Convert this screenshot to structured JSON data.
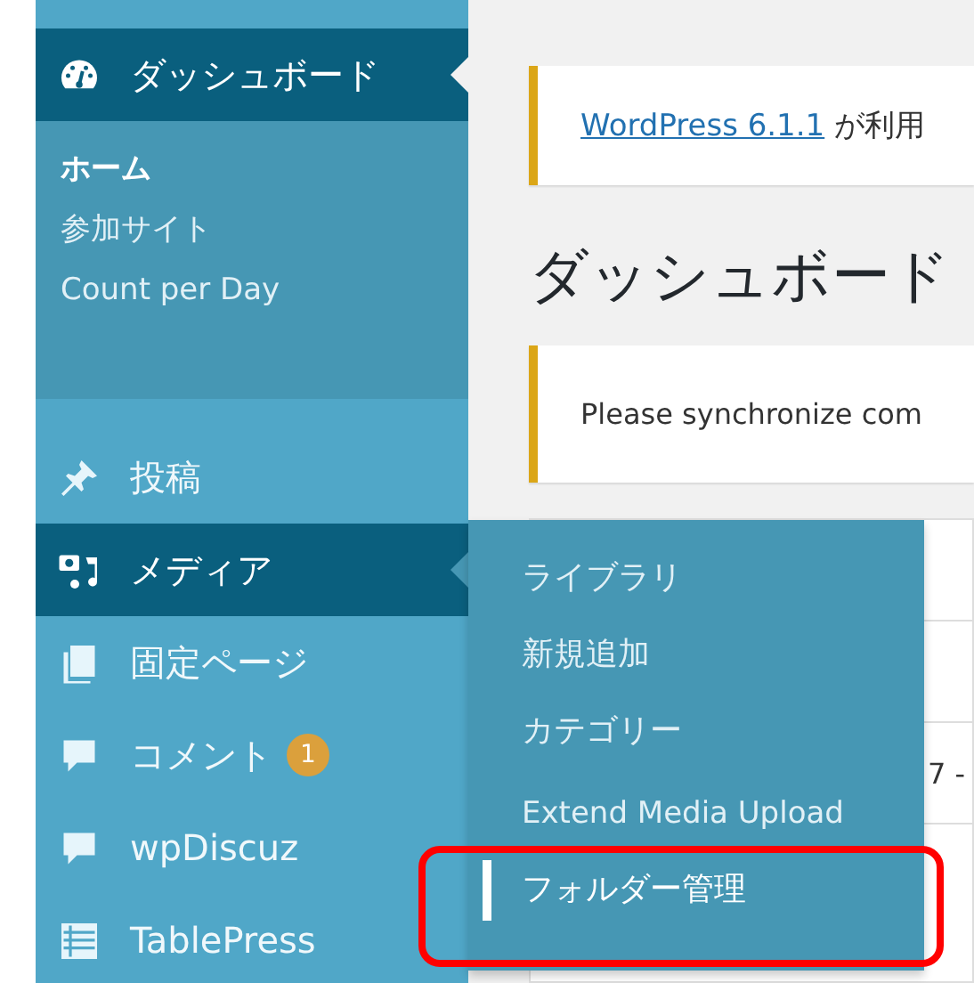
{
  "menu": [
    {
      "label": "ダッシュボード",
      "kind": "gauge",
      "selected": true,
      "submenu": [
        {
          "label": "ホーム",
          "selected": true
        },
        {
          "label": "参加サイト",
          "selected": false
        },
        {
          "label": "Count per Day",
          "selected": false
        }
      ]
    },
    {
      "label": "投稿",
      "kind": "pin",
      "selected": false
    },
    {
      "label": "メディア",
      "kind": "media",
      "selected": true,
      "flyout": [
        {
          "label": "ライブラリ",
          "selected": false,
          "highlighted": false
        },
        {
          "label": "新規追加",
          "selected": false,
          "highlighted": false
        },
        {
          "label": "カテゴリー",
          "selected": false,
          "highlighted": false
        },
        {
          "label": "Extend Media Upload",
          "selected": false,
          "highlighted": false
        },
        {
          "label": "フォルダー管理",
          "selected": true,
          "highlighted": true
        }
      ]
    },
    {
      "label": "固定ページ",
      "kind": "pages",
      "selected": false
    },
    {
      "label": "コメント",
      "kind": "comment",
      "selected": false,
      "badge": "1"
    },
    {
      "label": "wpDiscuz",
      "kind": "comment",
      "selected": false
    },
    {
      "label": "TablePress",
      "kind": "table",
      "selected": false
    }
  ],
  "notices": [
    {
      "link": "WordPress 6.1.1",
      "text": " が利用"
    },
    {
      "text": "Please synchronize com"
    }
  ],
  "heading": "ダッシュボード",
  "panel": {
    "fragment": "7 -"
  }
}
